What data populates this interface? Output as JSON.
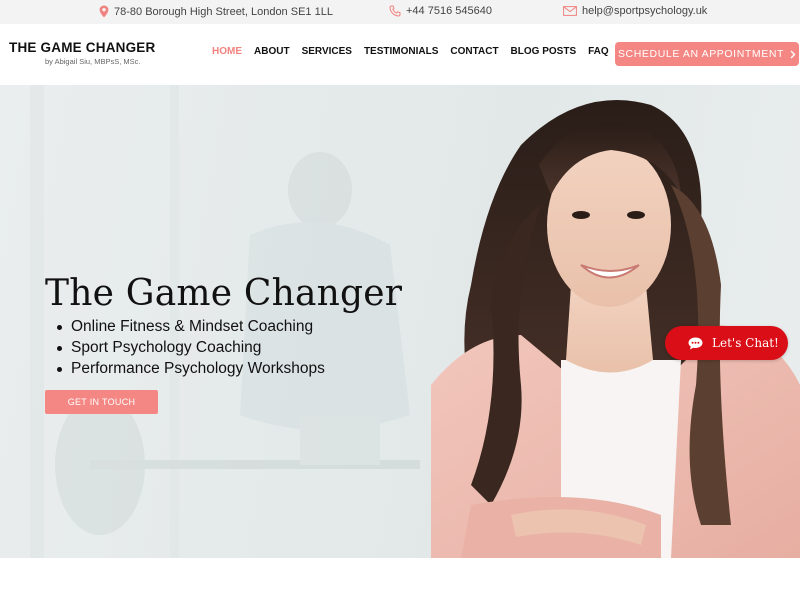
{
  "topbar": {
    "address": "78-80 Borough High Street, London SE1 1LL",
    "phone": "+44 7516 545640",
    "email": "help@sportpsychology.uk",
    "icons": {
      "address": "map-pin-icon",
      "phone": "phone-icon",
      "email": "mail-icon"
    },
    "icon_color": "#f08380"
  },
  "header": {
    "brand_title": "THE GAME CHANGER",
    "brand_subtitle": "by Abigail Siu, MBPsS, MSc.",
    "nav": {
      "home": "HOME",
      "about": "ABOUT",
      "services": "SERVICES",
      "testimonials": "TESTIMONIALS",
      "contact": "CONTACT",
      "blog": "BLOG POSTS",
      "faq": "FAQ"
    },
    "active_nav": "home",
    "cta_label": "SCHEDULE AN APPOINTMENT",
    "cta_icon": "chevron-right-icon"
  },
  "hero": {
    "title": "The Game Changer",
    "bullets": [
      "Online Fitness & Mindset Coaching",
      "Sport Psychology Coaching",
      "Performance Psychology Workshops"
    ],
    "cta_label": "GET IN TOUCH"
  },
  "chat": {
    "label": "Let's Chat!",
    "icon": "chat-bubble-icon"
  },
  "colors": {
    "accent": "#f48783",
    "chat": "#d90e17",
    "topbar_bg": "#f3f3f3"
  }
}
